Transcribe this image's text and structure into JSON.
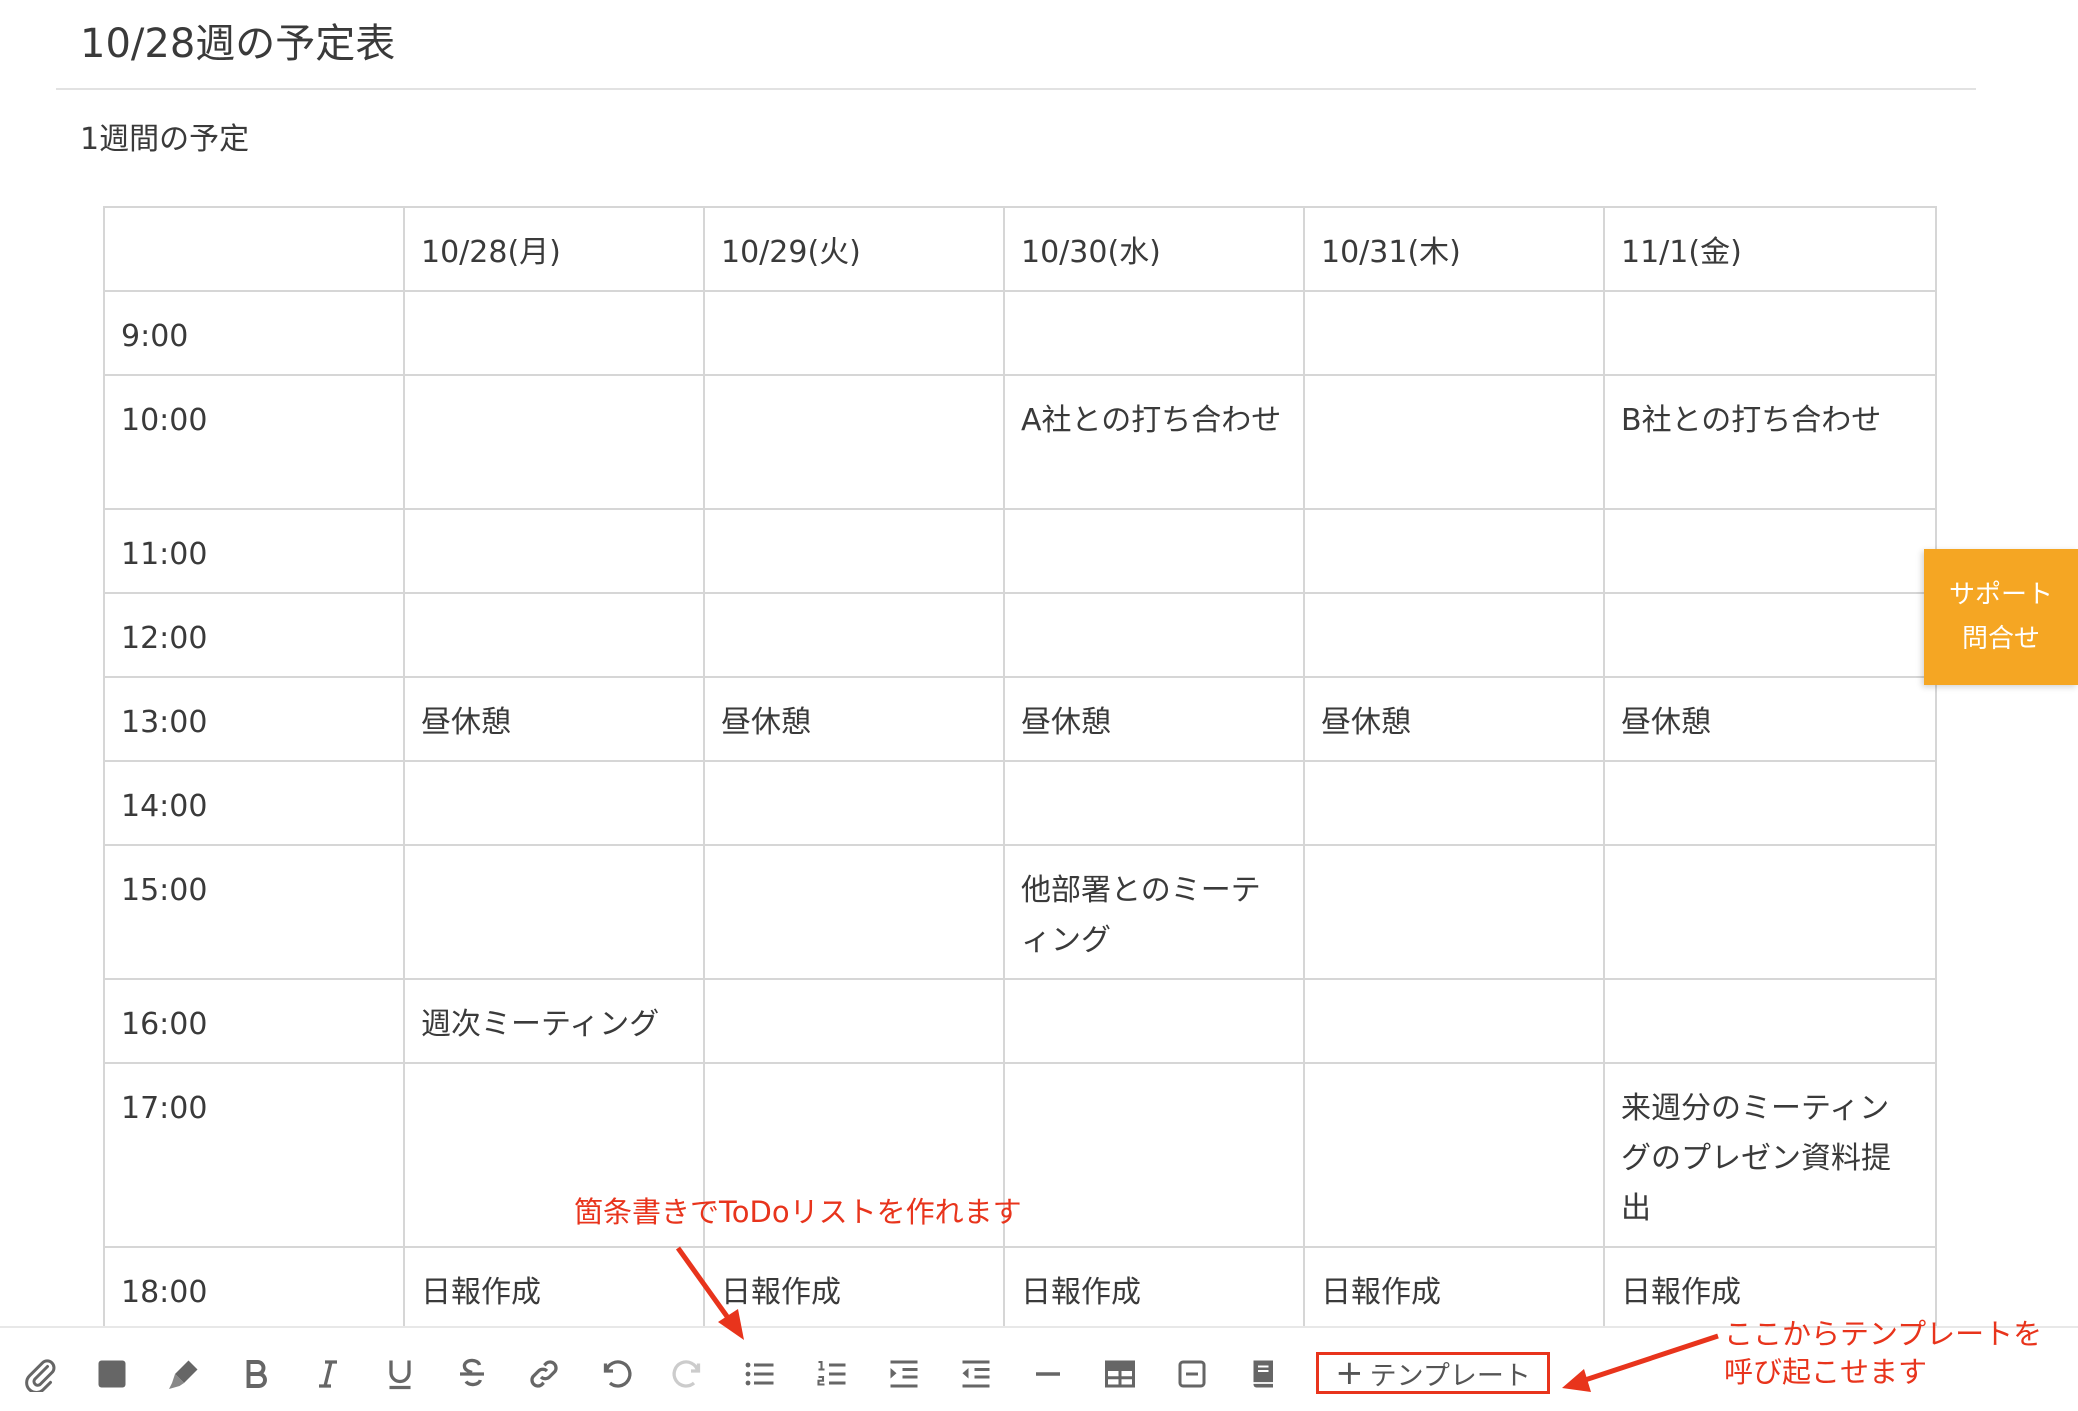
{
  "page": {
    "title": "10/28週の予定表",
    "subtitle": "1週間の予定"
  },
  "table": {
    "headers": [
      "",
      "10/28(月)",
      "10/29(火)",
      "10/30(水)",
      "10/31(木)",
      "11/1(金)"
    ],
    "rows": [
      {
        "time": "9:00",
        "cells": [
          "",
          "",
          "",
          "",
          ""
        ]
      },
      {
        "time": "10:00",
        "cells": [
          "",
          "",
          "A社との打ち合わせ",
          "",
          "B社との打ち合わせ"
        ]
      },
      {
        "time": "11:00",
        "cells": [
          "",
          "",
          "",
          "",
          ""
        ]
      },
      {
        "time": "12:00",
        "cells": [
          "",
          "",
          "",
          "",
          ""
        ]
      },
      {
        "time": "13:00",
        "cells": [
          "昼休憩",
          "昼休憩",
          "昼休憩",
          "昼休憩",
          "昼休憩"
        ]
      },
      {
        "time": "14:00",
        "cells": [
          "",
          "",
          "",
          "",
          ""
        ]
      },
      {
        "time": "15:00",
        "cells": [
          "",
          "",
          "他部署とのミーティング",
          "",
          ""
        ]
      },
      {
        "time": "16:00",
        "cells": [
          "週次ミーティング",
          "",
          "",
          "",
          ""
        ]
      },
      {
        "time": "17:00",
        "cells": [
          "",
          "",
          "",
          "",
          "来週分のミーティングのプレゼン資料提出"
        ]
      },
      {
        "time": "18:00",
        "cells": [
          "日報作成",
          "日報作成",
          "日報作成",
          "日報作成",
          "日報作成"
        ]
      }
    ]
  },
  "support": {
    "line1": "サポート",
    "line2": "問合せ",
    "color": "#f5a623"
  },
  "toolbar": {
    "buttons": [
      {
        "icon": "attachment-icon",
        "enabled": true
      },
      {
        "icon": "text-color-icon",
        "enabled": true
      },
      {
        "icon": "highlighter-icon",
        "enabled": true
      },
      {
        "icon": "bold-icon",
        "enabled": true
      },
      {
        "icon": "italic-icon",
        "enabled": true
      },
      {
        "icon": "underline-icon",
        "enabled": true
      },
      {
        "icon": "strikethrough-icon",
        "enabled": true
      },
      {
        "icon": "link-icon",
        "enabled": true
      },
      {
        "icon": "undo-icon",
        "enabled": true
      },
      {
        "icon": "redo-icon",
        "enabled": false
      },
      {
        "icon": "bullet-list-icon",
        "enabled": true
      },
      {
        "icon": "numbered-list-icon",
        "enabled": true
      },
      {
        "icon": "indent-icon",
        "enabled": true
      },
      {
        "icon": "outdent-icon",
        "enabled": true
      },
      {
        "icon": "horizontal-rule-icon",
        "enabled": true
      },
      {
        "icon": "table-icon",
        "enabled": true
      },
      {
        "icon": "collapse-icon",
        "enabled": true
      },
      {
        "icon": "document-icon",
        "enabled": true
      }
    ],
    "template_label": "テンプレート"
  },
  "annotations": {
    "todo_callout": "箇条書きでToDoリストを作れます",
    "template_callout_line1": "ここからテンプレートを",
    "template_callout_line2": "呼び起こせます",
    "accent_color": "#e8341c"
  }
}
